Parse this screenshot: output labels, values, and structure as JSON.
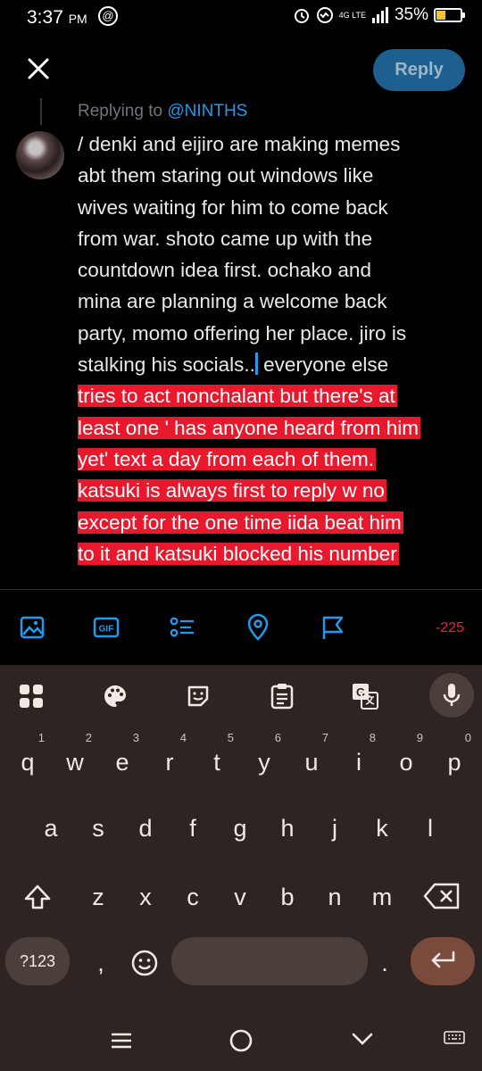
{
  "status_bar": {
    "time": "3:37",
    "ampm": "PM",
    "network": "4G LTE",
    "battery": "35%",
    "battery_level": 0.35
  },
  "header": {
    "close_icon": "close-icon",
    "reply_label": "Reply"
  },
  "reply_context": {
    "prefix": "Replying to ",
    "handle": "@NINTHS"
  },
  "tweet": {
    "lines_plain": [
      "/ denki and eijiro are making memes",
      "abt them staring out windows like",
      "wives waiting for him to come back",
      "from war. shoto came up with the",
      "countdown idea first. ochako and",
      "mina are planning a welcome back",
      "party, momo offering her place. jiro is",
      "stalking his socials.."
    ],
    "line8_after_caret": " everyone else",
    "lines_highlighted": [
      "tries to act nonchalant but there's at",
      "least one ' has anyone heard from him",
      "yet' text a day from each of them.",
      "katsuki is always first to reply w no",
      "except for the one time iida beat him",
      "to it and katsuki blocked his number"
    ]
  },
  "toolbar": {
    "icons": [
      "image-icon",
      "gif-icon",
      "poll-icon",
      "location-icon",
      "flag-icon"
    ],
    "gif_label": "GIF",
    "char_count": "-225"
  },
  "keyboard": {
    "tools": [
      "apps-grid-icon",
      "palette-icon",
      "sticker-icon",
      "clipboard-icon",
      "translate-icon",
      "mic-icon"
    ],
    "row1": [
      "q",
      "w",
      "e",
      "r",
      "t",
      "y",
      "u",
      "i",
      "o",
      "p"
    ],
    "row1_hints": [
      "1",
      "2",
      "3",
      "4",
      "5",
      "6",
      "7",
      "8",
      "9",
      "0"
    ],
    "row2": [
      "a",
      "s",
      "d",
      "f",
      "g",
      "h",
      "j",
      "k",
      "l"
    ],
    "row3": [
      "z",
      "x",
      "c",
      "v",
      "b",
      "n",
      "m"
    ],
    "sym_label": "?123",
    "comma": ",",
    "period": "."
  },
  "colors": {
    "accent": "#1d9bf0",
    "highlight": "#e8192c",
    "warning": "#f4212e",
    "keyboard_bg": "#2e2522"
  }
}
